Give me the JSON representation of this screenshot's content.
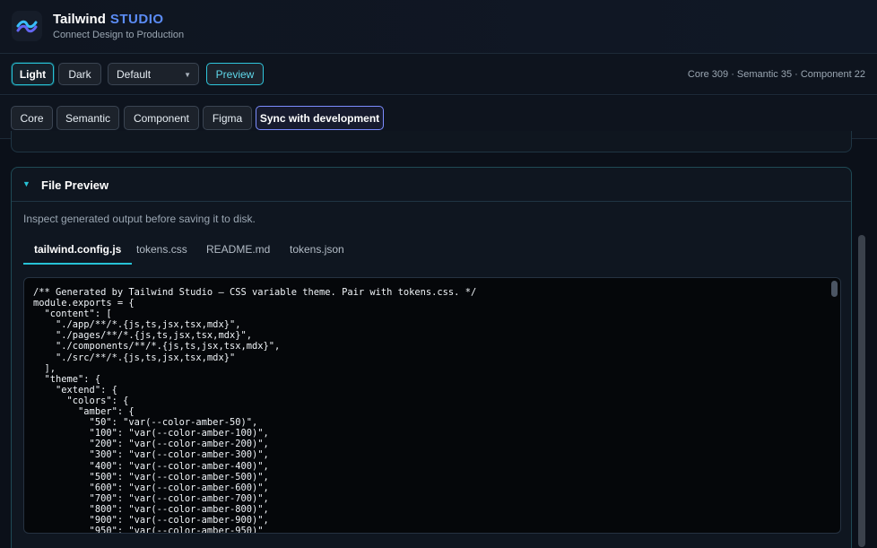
{
  "header": {
    "brand_main": "Tailwind",
    "brand_accent": "STUDIO",
    "tagline": "Connect Design to Production",
    "logo_icon": "tailwind-wave-icon"
  },
  "toolbar": {
    "light_label": "Light",
    "dark_label": "Dark",
    "theme_select_value": "Default",
    "preview_label": "Preview",
    "counts": "Core 309 · Semantic 35 · Component 22"
  },
  "tabs": {
    "core": "Core",
    "semantic": "Semantic",
    "component": "Component",
    "figma": "Figma",
    "sync": "Sync with development"
  },
  "panel": {
    "title": "File Preview",
    "description": "Inspect generated output before saving it to disk.",
    "file_tabs": [
      "tailwind.config.js",
      "tokens.css",
      "README.md",
      "tokens.json"
    ],
    "active_file": "tailwind.config.js",
    "code": "/** Generated by Tailwind Studio — CSS variable theme. Pair with tokens.css. */\nmodule.exports = {\n  \"content\": [\n    \"./app/**/*.{js,ts,jsx,tsx,mdx}\",\n    \"./pages/**/*.{js,ts,jsx,tsx,mdx}\",\n    \"./components/**/*.{js,ts,jsx,tsx,mdx}\",\n    \"./src/**/*.{js,ts,jsx,tsx,mdx}\"\n  ],\n  \"theme\": {\n    \"extend\": {\n      \"colors\": {\n        \"amber\": {\n          \"50\": \"var(--color-amber-50)\",\n          \"100\": \"var(--color-amber-100)\",\n          \"200\": \"var(--color-amber-200)\",\n          \"300\": \"var(--color-amber-300)\",\n          \"400\": \"var(--color-amber-400)\",\n          \"500\": \"var(--color-amber-500)\",\n          \"600\": \"var(--color-amber-600)\",\n          \"700\": \"var(--color-amber-700)\",\n          \"800\": \"var(--color-amber-800)\",\n          \"900\": \"var(--color-amber-900)\",\n          \"950\": \"var(--color-amber-950)\""
  },
  "colors": {
    "accent_cyan": "#27c2d6",
    "accent_blue": "#5b8cf5",
    "sync_border": "#7b8cff",
    "background": "#0c111b"
  }
}
